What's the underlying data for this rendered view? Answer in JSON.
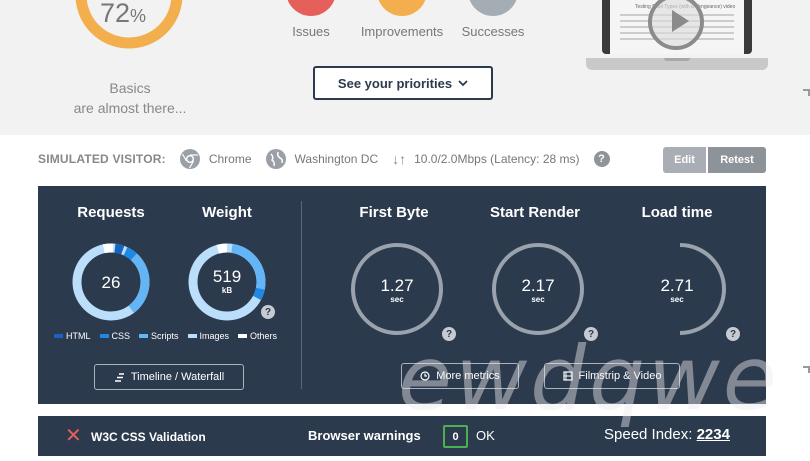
{
  "summary": {
    "score_value": "72",
    "score_unit": "%",
    "status_line1": "Basics",
    "status_line2": "are almost there...",
    "bubbles": [
      {
        "label": "Issues",
        "color": "#e5605b"
      },
      {
        "label": "Improvements",
        "color": "#f3ae4e"
      },
      {
        "label": "Successes",
        "color": "#a5adb4"
      }
    ],
    "priorities_button": "See your priorities",
    "video_doc_title": "Testing Pixel Types (with a Vengeance) video"
  },
  "visitor": {
    "label": "SIMULATED VISITOR:",
    "browser": "Chrome",
    "location": "Washington DC",
    "connection": "10.0/2.0Mbps (Latency: 28 ms)",
    "edit_label": "Edit",
    "retest_label": "Retest"
  },
  "metrics": {
    "requests": {
      "title": "Requests",
      "value": "26"
    },
    "weight": {
      "title": "Weight",
      "value": "519",
      "unit": "kB"
    },
    "first_byte": {
      "title": "First Byte",
      "value": "1.27",
      "unit": "sec",
      "fill": 0.82,
      "color": "#e5605b"
    },
    "start_render": {
      "title": "Start Render",
      "value": "2.17",
      "unit": "sec",
      "fill": 0.8,
      "color": "#e5605b"
    },
    "load_time": {
      "title": "Load time",
      "value": "2.71",
      "unit": "sec",
      "fill": 0.45,
      "color": "#f3ae4e"
    },
    "legend": [
      {
        "label": "HTML",
        "color": "#1565c0"
      },
      {
        "label": "CSS",
        "color": "#1e88e5"
      },
      {
        "label": "Scripts",
        "color": "#64b5f6"
      },
      {
        "label": "Images",
        "color": "#bbdefb"
      },
      {
        "label": "Others",
        "color": "#ffffff"
      }
    ],
    "timeline_button": "Timeline / Waterfall",
    "more_metrics_button": "More metrics",
    "filmstrip_button": "Filmstrip & Video",
    "help_icon": "?"
  },
  "bottom": {
    "validation": "W3C CSS Validation",
    "warnings_label": "Browser warnings",
    "warnings_count": "0",
    "warnings_status": "OK",
    "speed_index_label": "Speed Index:",
    "speed_index_value": "2234"
  },
  "watermark": "ewdqwe"
}
